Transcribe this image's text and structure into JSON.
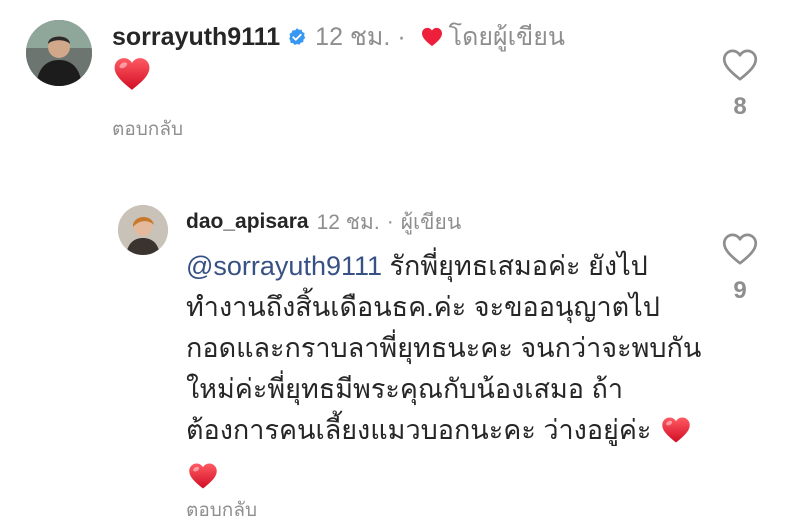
{
  "comment": {
    "username": "sorrayuth9111",
    "time": "12 ชม.",
    "separator": "·",
    "author_liked_label": "โดยผู้เขียน",
    "emoji_icon": "red-heart-emoji",
    "reply_label": "ตอบกลับ",
    "like_count": "8"
  },
  "reply": {
    "username": "dao_apisara",
    "time": "12 ชม.",
    "separator": "·",
    "author_label": "ผู้เขียน",
    "mention": "@sorrayuth9111",
    "text": "รักพี่ยุทธเสมอค่ะ ยังไปทำงานถึงสิ้นเดือนธค.ค่ะ จะขออนุญาตไปกอดและกราบลาพี่ยุทธนะคะ จนกว่าจะพบกันใหม่ค่ะพี่ยุทธมีพระคุณกับน้องเสมอ ถ้าต้องการคนเลี้ยงแมวบอกนะคะ ว่างอยู่ค่ะ",
    "emoji_icons": [
      "red-heart-emoji",
      "red-heart-emoji"
    ],
    "reply_label": "ตอบกลับ",
    "like_count": "9"
  },
  "colors": {
    "heart": "#ED1F3A",
    "verified": "#3897F0",
    "muted": "#8E8E8E",
    "mention": "#385185"
  }
}
